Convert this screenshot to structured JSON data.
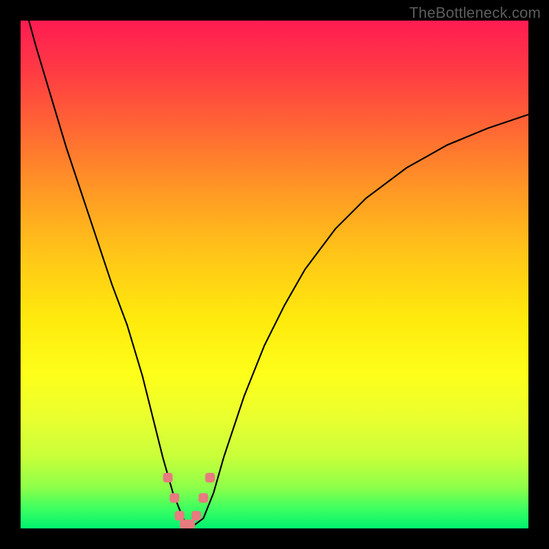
{
  "watermark": "TheBottleneck.com",
  "chart_data": {
    "type": "line",
    "title": "",
    "xlabel": "",
    "ylabel": "",
    "xlim": [
      0,
      100
    ],
    "ylim": [
      0,
      100
    ],
    "grid": false,
    "legend": false,
    "background_gradient": {
      "top": "#ff1c52",
      "mid": "#ffe80d",
      "bottom": "#00f26f"
    },
    "series": [
      {
        "name": "bottleneck-curve",
        "color": "#000000",
        "x": [
          0.0,
          3.0,
          6.0,
          9.0,
          12.0,
          15.0,
          18.0,
          21.0,
          24.0,
          26.0,
          28.0,
          30.0,
          32.0,
          33.0,
          34.0,
          36.0,
          38.0,
          40.0,
          44.0,
          48.0,
          52.0,
          56.0,
          62.0,
          68.0,
          76.0,
          84.0,
          92.0,
          100.0
        ],
        "y": [
          106.0,
          95.0,
          85.0,
          75.0,
          66.0,
          57.0,
          48.0,
          40.0,
          30.0,
          22.0,
          14.0,
          7.0,
          2.0,
          0.5,
          0.5,
          2.0,
          7.0,
          14.0,
          26.0,
          36.0,
          44.0,
          51.0,
          59.0,
          65.0,
          71.0,
          75.5,
          78.8,
          81.5
        ]
      }
    ],
    "markers": {
      "name": "highlight-points",
      "color": "#e77b7f",
      "shape": "rounded-rect",
      "x": [
        29.0,
        30.3,
        31.3,
        32.3,
        33.4,
        34.6,
        36.0,
        37.3
      ],
      "y": [
        10.0,
        6.0,
        2.5,
        0.8,
        0.8,
        2.5,
        6.0,
        10.0
      ]
    }
  }
}
